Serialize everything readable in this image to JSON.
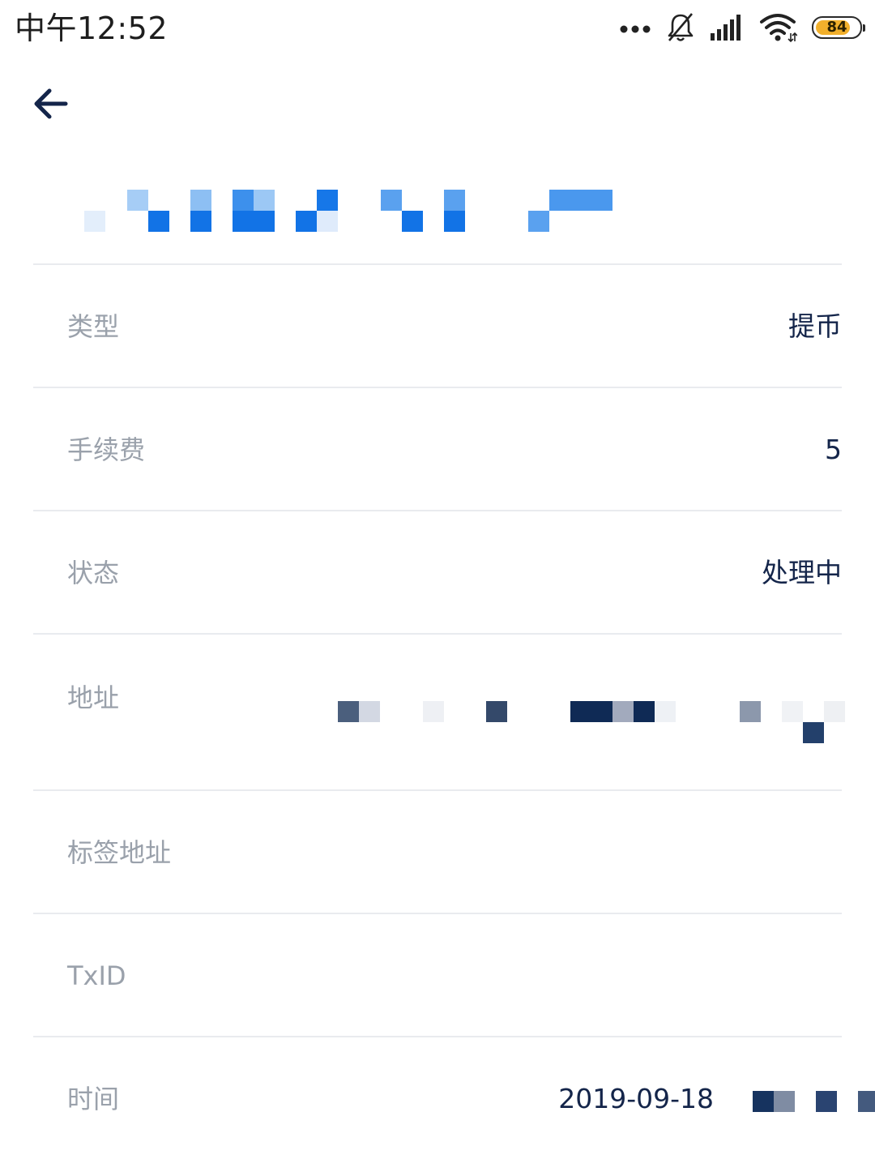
{
  "status_bar": {
    "time": "中午12:52",
    "battery_level": "84",
    "battery_fraction": 0.84,
    "icons": [
      "dots-icon",
      "bell-muted-icon",
      "signal-icon",
      "wifi-icon",
      "battery-icon"
    ],
    "battery_color": "#f2b02c"
  },
  "header": {
    "back_icon": "arrow-left-icon"
  },
  "details": {
    "rows": [
      {
        "label": "类型",
        "value": "提币"
      },
      {
        "label": "手续费",
        "value": "5"
      },
      {
        "label": "状态",
        "value": "处理中"
      },
      {
        "label": "地址",
        "value": ""
      },
      {
        "label": "标签地址",
        "value": ""
      },
      {
        "label": "TxID",
        "value": ""
      },
      {
        "label": "时间",
        "value": "2019-09-18"
      }
    ]
  },
  "colors": {
    "label": "#9aa1ab",
    "value": "#14254a",
    "divider": "#e9ebef",
    "accent": "#1a73e8"
  }
}
